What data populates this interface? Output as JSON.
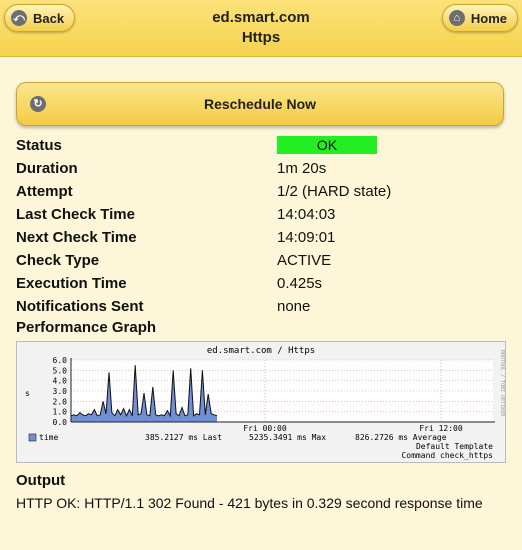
{
  "header": {
    "back_label": "Back",
    "home_label": "Home",
    "host": "ed.smart.com",
    "service": "Https"
  },
  "reschedule_label": "Reschedule Now",
  "details": {
    "status_label": "Status",
    "status_value": "OK",
    "status_color": "#22ee22",
    "duration_label": "Duration",
    "duration_value": "1m 20s",
    "attempt_label": "Attempt",
    "attempt_value": "1/2 (HARD state)",
    "last_check_label": "Last Check Time",
    "last_check_value": "14:04:03",
    "next_check_label": "Next Check Time",
    "next_check_value": "14:09:01",
    "check_type_label": "Check Type",
    "check_type_value": "ACTIVE",
    "exec_time_label": "Execution Time",
    "exec_time_value": "0.425s",
    "notif_label": "Notifications Sent",
    "notif_value": "none"
  },
  "perf_label": "Performance Graph",
  "graph": {
    "title": "ed.smart.com / Https",
    "ylabel": "s",
    "yticks": [
      "6.0",
      "5.0",
      "4.0",
      "3.0",
      "2.0",
      "1.0",
      "0.0"
    ],
    "xticks": [
      "Fri 00:00",
      "Fri 12:00"
    ],
    "side_text": "RRDTOOL / TOBI OETIKER",
    "legend_name": "time",
    "legend_last": "385.2127 ms Last",
    "legend_max": "5235.3491 ms Max",
    "legend_avg": "826.2726 ms Average",
    "template": "Default Template",
    "command": "Command check_https"
  },
  "chart_data": {
    "type": "area",
    "title": "ed.smart.com / Https",
    "ylabel": "s",
    "ylim": [
      0,
      6
    ],
    "x": [
      0,
      0.02,
      0.04,
      0.06,
      0.08,
      0.1,
      0.12,
      0.14,
      0.16,
      0.18,
      0.2,
      0.22,
      0.24,
      0.26,
      0.28,
      0.3,
      0.32,
      0.34,
      0.36,
      0.38,
      0.4,
      0.42,
      0.44,
      0.46,
      0.48,
      0.5,
      0.52,
      0.54,
      0.56,
      0.58,
      0.6,
      0.62,
      0.64,
      0.66,
      0.68,
      0.7,
      0.72,
      0.74,
      0.76,
      0.78,
      0.8,
      0.82,
      0.84,
      0.86,
      0.88,
      0.9,
      0.92,
      0.94,
      0.96,
      0.98,
      1.0
    ],
    "series": [
      {
        "name": "time",
        "values": [
          0.6,
          0.7,
          0.6,
          0.9,
          0.7,
          0.6,
          0.8,
          0.7,
          1.2,
          0.6,
          0.7,
          2.0,
          0.8,
          4.8,
          0.9,
          0.6,
          1.2,
          0.7,
          1.3,
          0.6,
          1.2,
          0.6,
          5.5,
          0.7,
          0.8,
          2.8,
          0.7,
          0.6,
          3.4,
          0.7,
          0.6,
          0.7,
          0.6,
          1.1,
          0.6,
          5.0,
          0.8,
          0.6,
          1.4,
          0.6,
          0.7,
          5.2,
          0.6,
          0.8,
          0.7,
          5.0,
          0.7,
          2.7,
          0.8,
          0.7,
          0.6
        ]
      }
    ]
  }
}
